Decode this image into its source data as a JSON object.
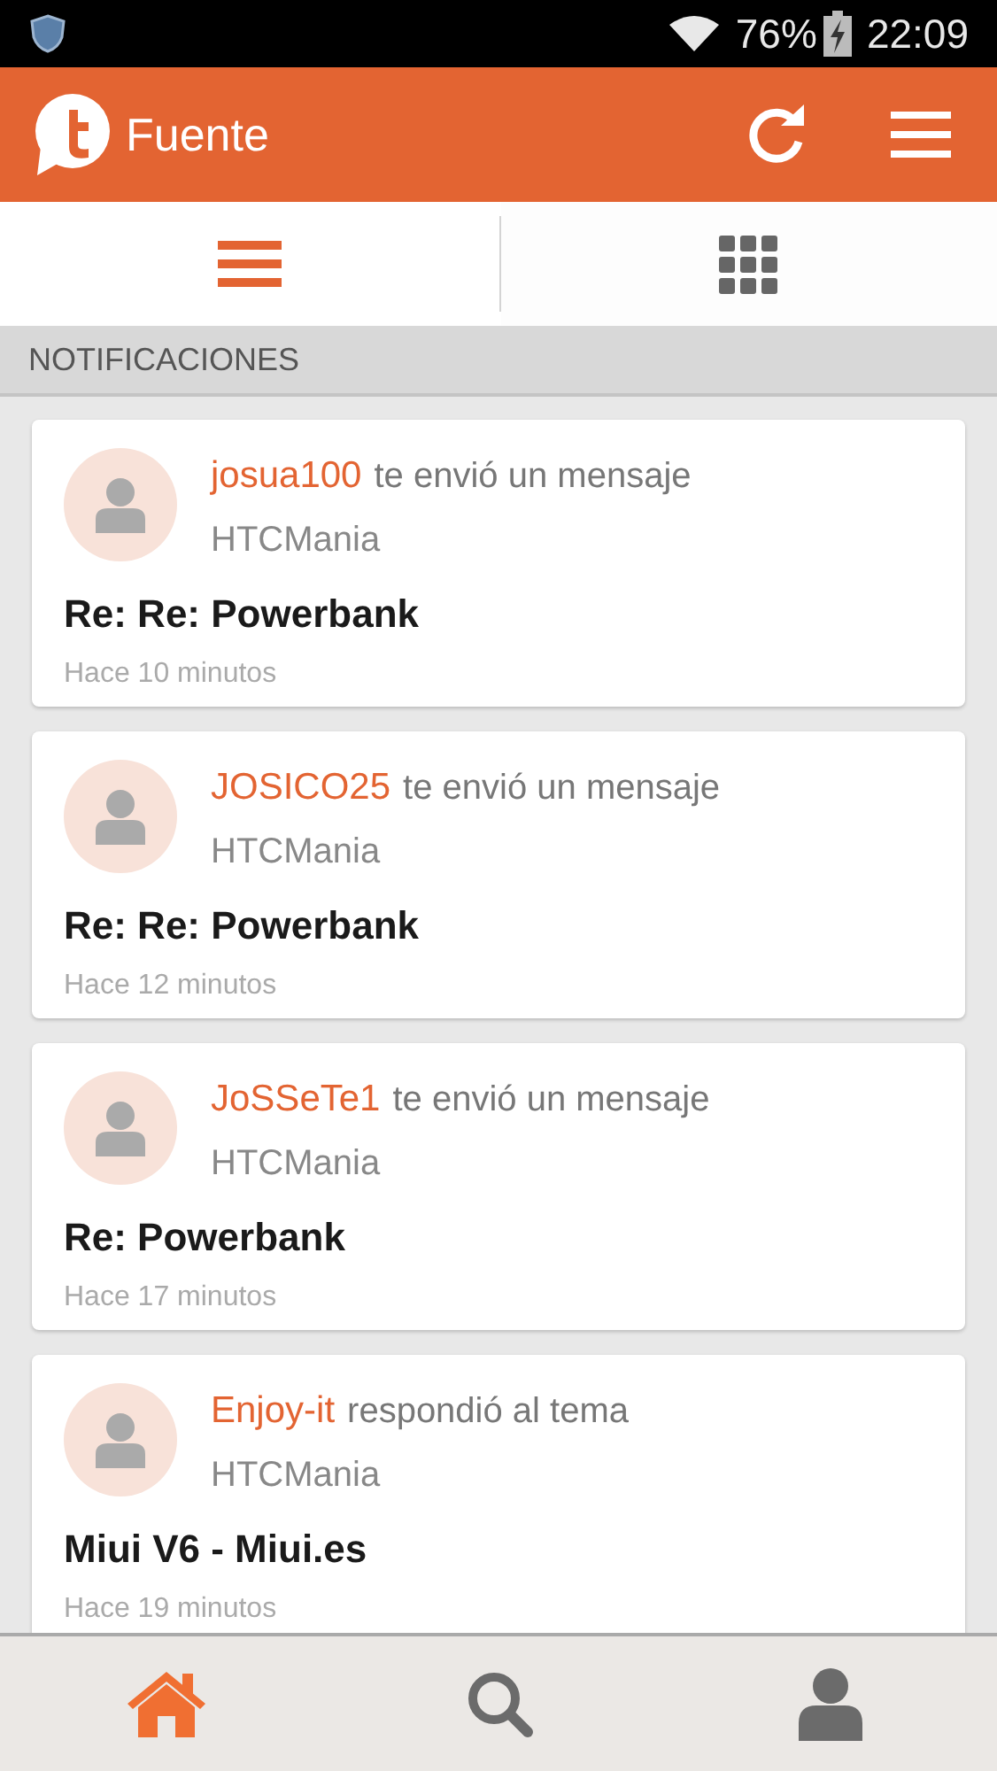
{
  "status_bar": {
    "battery": "76%",
    "time": "22:09"
  },
  "app_bar": {
    "title": "Fuente"
  },
  "view_tabs": [
    {
      "kind": "list",
      "selected": true
    },
    {
      "kind": "grid",
      "selected": false
    }
  ],
  "section": {
    "title": "NOTIFICACIONES"
  },
  "notifications": [
    {
      "user": "josua100",
      "action": "te envió un mensaje",
      "forum": "HTCMania",
      "title": "Re: Re: Powerbank",
      "time": "Hace 10 minutos"
    },
    {
      "user": "JOSICO25",
      "action": "te envió un mensaje",
      "forum": "HTCMania",
      "title": "Re: Re: Powerbank",
      "time": "Hace 12 minutos"
    },
    {
      "user": "JoSSeTe1",
      "action": "te envió un mensaje",
      "forum": "HTCMania",
      "title": "Re: Powerbank",
      "time": "Hace 17 minutos"
    },
    {
      "user": "Enjoy-it",
      "action": "respondió al tema",
      "forum": "HTCMania",
      "title": "Miui V6 - Miui.es",
      "time": "Hace 19 minutos"
    }
  ],
  "bottom_nav": [
    {
      "kind": "home",
      "selected": true
    },
    {
      "kind": "search",
      "selected": false
    },
    {
      "kind": "profile",
      "selected": false
    }
  ]
}
